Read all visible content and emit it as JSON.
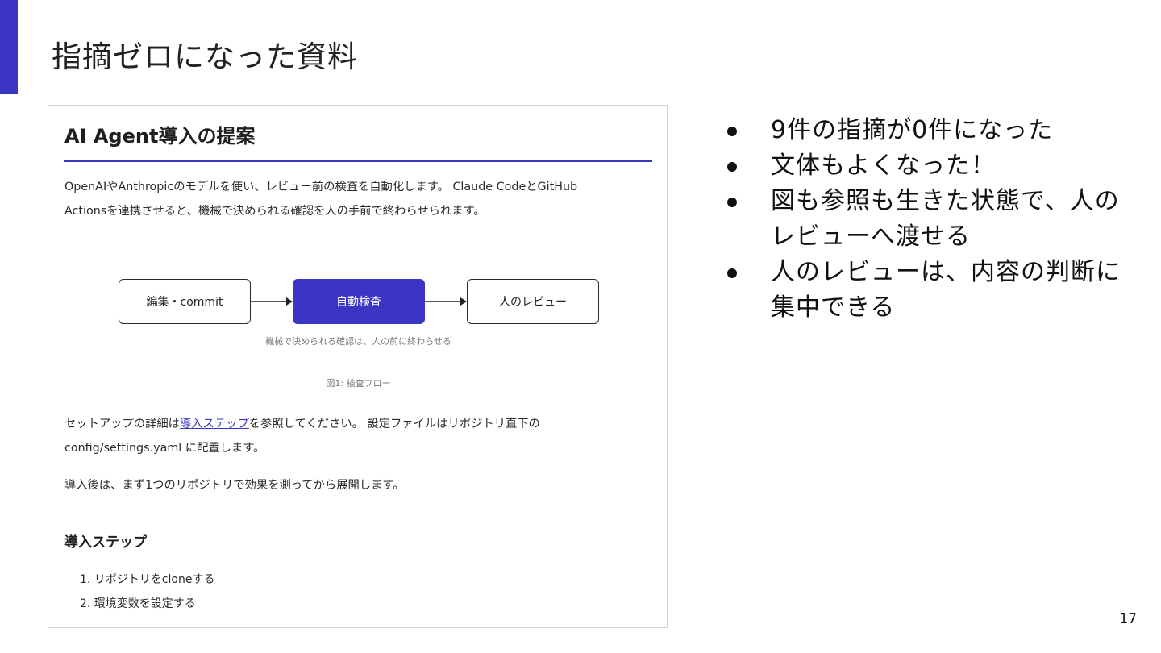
{
  "slide": {
    "title": "指摘ゼロになった資料",
    "page_number": "17",
    "accent_color": "#3b35c4"
  },
  "document": {
    "title": "AI Agent導入の提案",
    "intro_line1": "OpenAIやAnthropicのモデルを使い、レビュー前の検査を自動化します。 Claude CodeとGitHub",
    "intro_line2": "Actionsを連携させると、機械で決められる確認を人の手前で終わらせられます。",
    "flow": {
      "box1": "編集・commit",
      "box2": "自動検査",
      "box3": "人のレビュー",
      "caption": "機械で決められる確認は、人の前に終わらせる"
    },
    "figure_caption": "図1: 検査フロー",
    "setup_prefix": "セットアップの詳細は",
    "setup_link": "導入ステップ",
    "setup_suffix": "を参照してください。 設定ファイルはリポジトリ直下の",
    "setup_line2": "config/settings.yaml に配置します。",
    "rollout": "導入後は、まず1つのリポジトリで効果を測ってから展開します。",
    "steps_heading": "導入ステップ",
    "steps": [
      "1. リポジトリをcloneする",
      "2. 環境変数を設定する"
    ]
  },
  "bullets": [
    "9件の指摘が0件になった",
    "文体もよくなった！",
    "図も参照も生きた状態で、人のレビューへ渡せる",
    "人のレビューは、内容の判断に集中できる"
  ]
}
